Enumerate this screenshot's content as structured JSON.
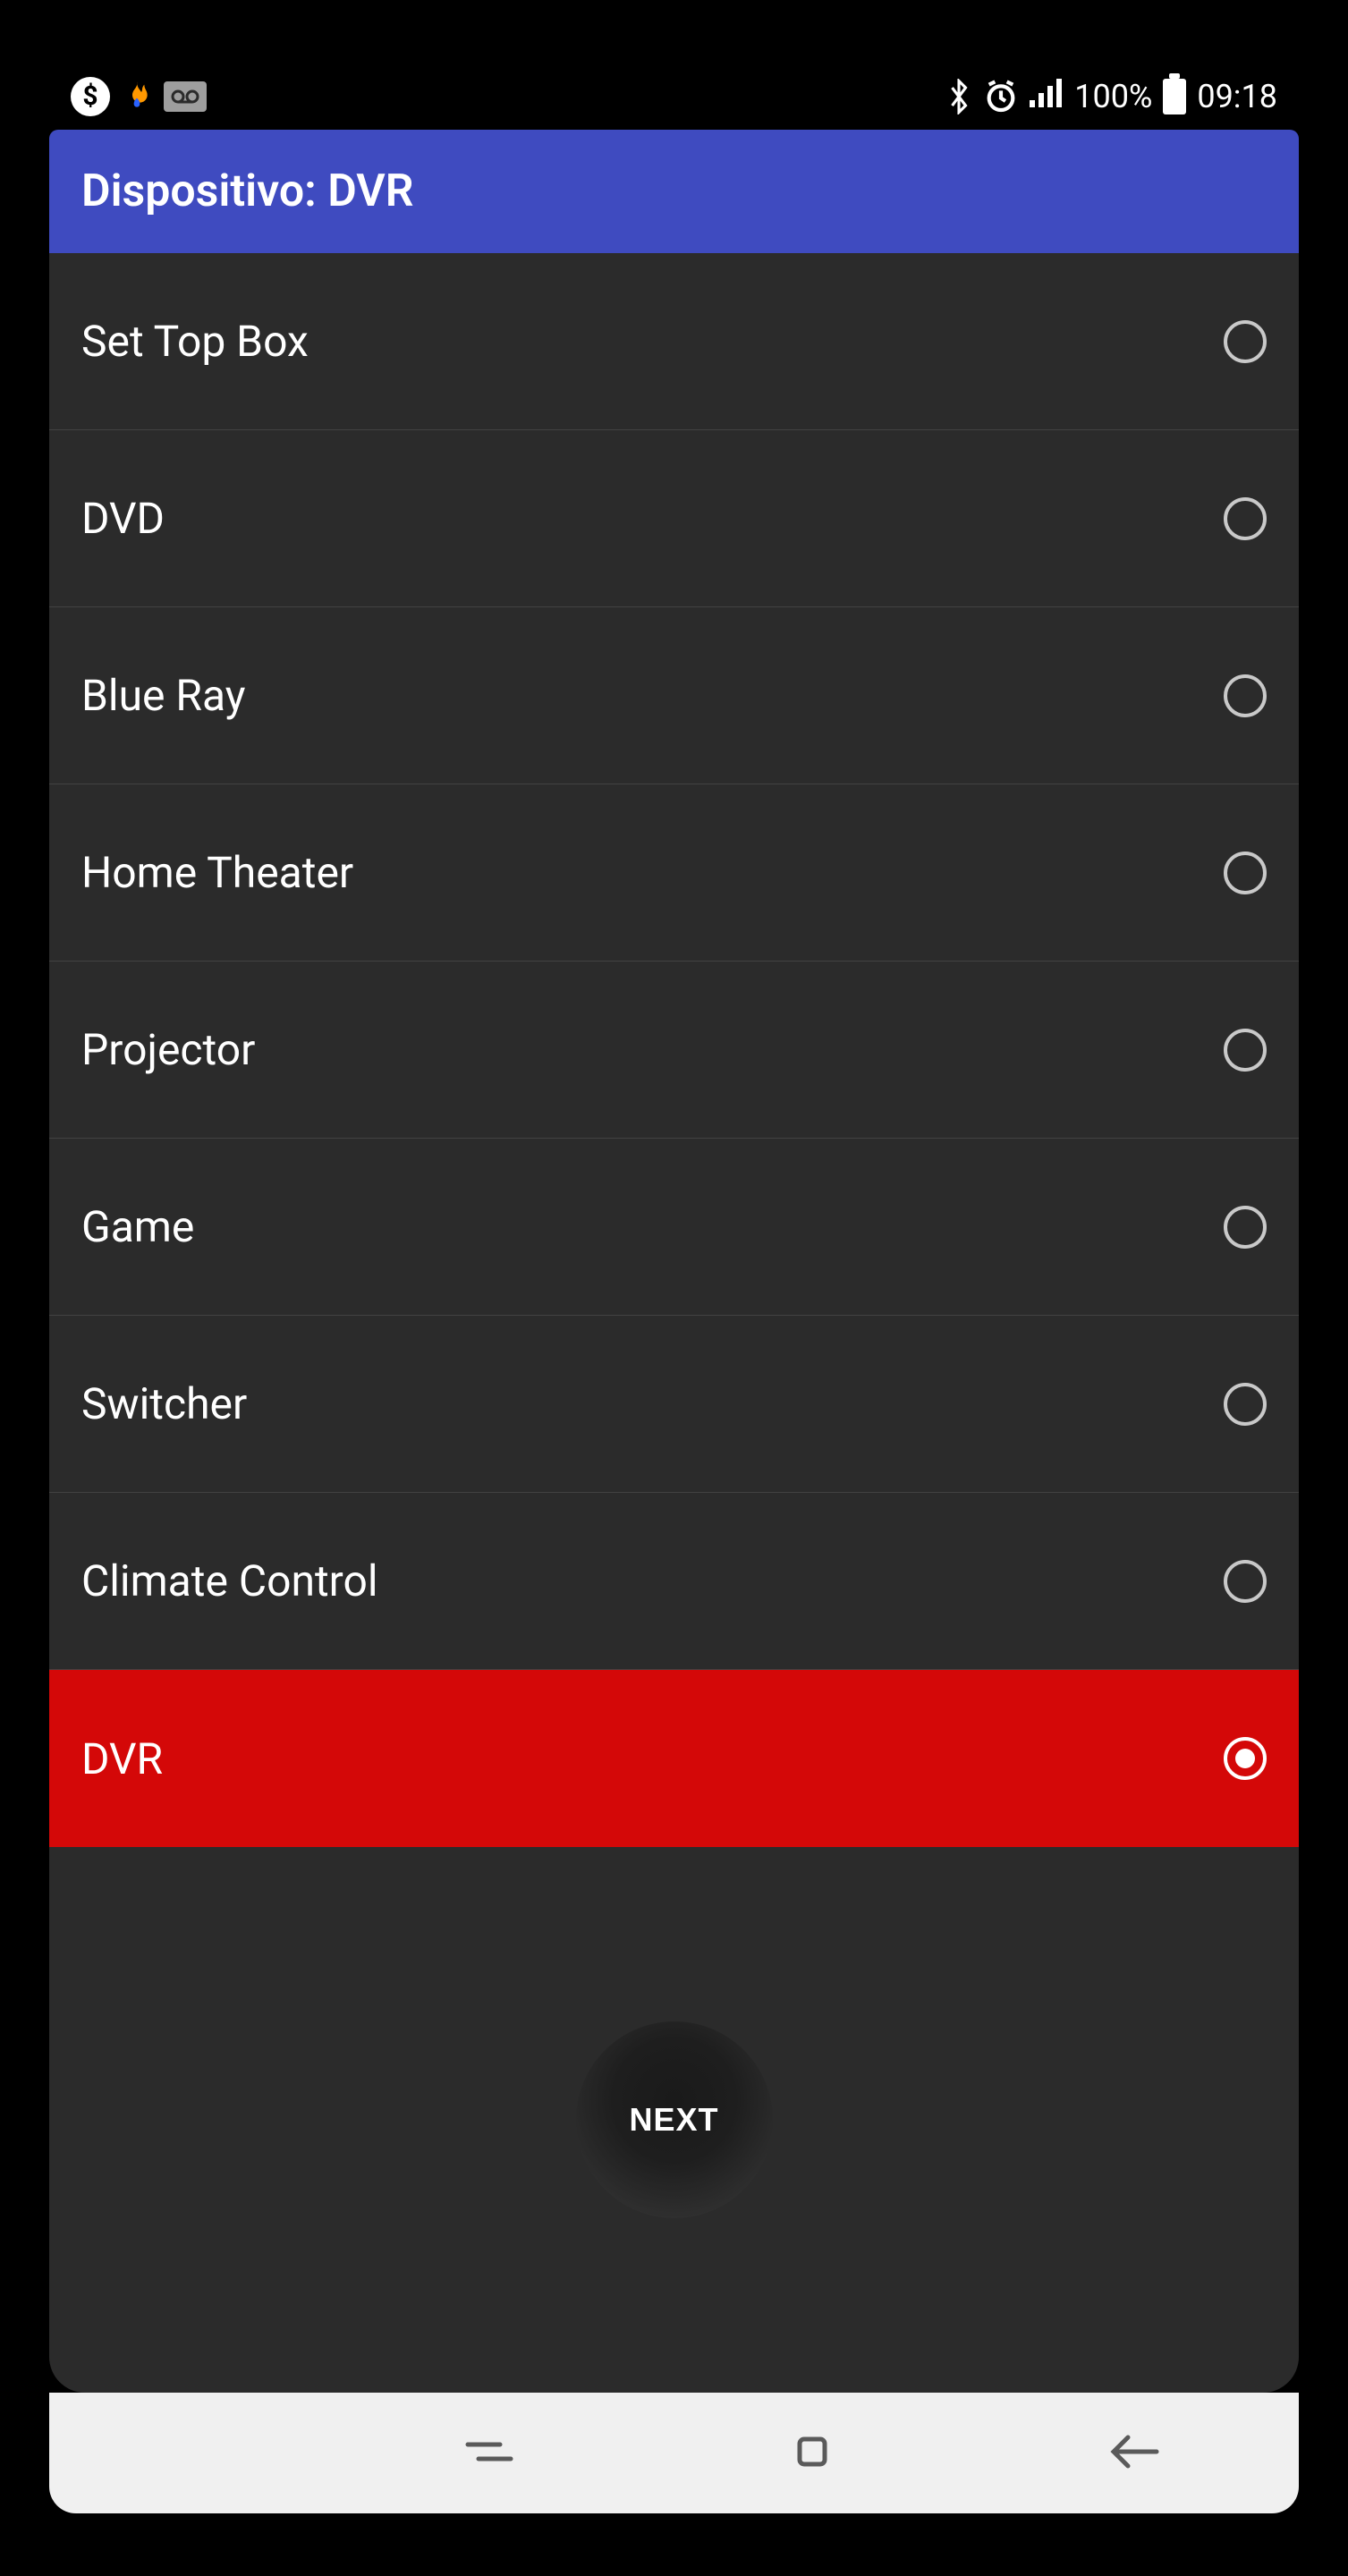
{
  "status": {
    "battery_pct": "100%",
    "time": "09:18"
  },
  "header": {
    "title": "Dispositivo: DVR"
  },
  "options": [
    {
      "label": "Set Top Box",
      "selected": false
    },
    {
      "label": "DVD",
      "selected": false
    },
    {
      "label": "Blue Ray",
      "selected": false
    },
    {
      "label": "Home Theater",
      "selected": false
    },
    {
      "label": "Projector",
      "selected": false
    },
    {
      "label": "Game",
      "selected": false
    },
    {
      "label": "Switcher",
      "selected": false
    },
    {
      "label": "Climate Control",
      "selected": false
    },
    {
      "label": "DVR",
      "selected": true
    }
  ],
  "next_button": {
    "label": "NEXT"
  },
  "colors": {
    "header_bg": "#3f4bc0",
    "selected_bg": "#d40808",
    "content_bg": "#2b2b2b"
  }
}
